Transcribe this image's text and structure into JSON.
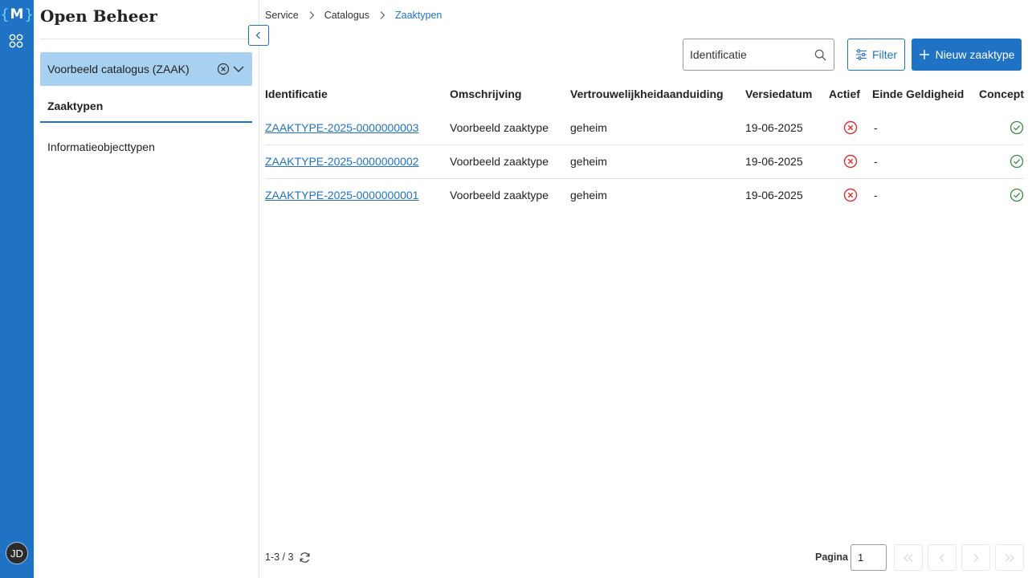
{
  "rail": {
    "logo_letter": "M",
    "user_initials": "JD"
  },
  "sidebar": {
    "brand": "Open Beheer",
    "catalog_select": "Voorbeeld catalogus (ZAAK)",
    "nav": [
      {
        "label": "Zaaktypen",
        "active": true
      },
      {
        "label": "Informatieobjecttypen",
        "active": false
      }
    ]
  },
  "breadcrumb": [
    "Service",
    "Catalogus",
    "Zaaktypen"
  ],
  "toolbar": {
    "search_value": "Identificatie",
    "filter_label": "Filter",
    "new_label": "Nieuw zaaktype"
  },
  "table": {
    "headers": [
      "Identificatie",
      "Omschrijving",
      "Vertrouwelijkheidaanduiding",
      "Versiedatum",
      "Actief",
      "Einde Geldigheid",
      "Concept"
    ],
    "rows": [
      {
        "id": "ZAAKTYPE-2025-0000000003",
        "omschrijving": "Voorbeeld zaaktype",
        "vertrouwelijkheid": "geheim",
        "versiedatum": "19-06-2025",
        "actief": false,
        "einde": "-",
        "concept": true
      },
      {
        "id": "ZAAKTYPE-2025-0000000002",
        "omschrijving": "Voorbeeld zaaktype",
        "vertrouwelijkheid": "geheim",
        "versiedatum": "19-06-2025",
        "actief": false,
        "einde": "-",
        "concept": true
      },
      {
        "id": "ZAAKTYPE-2025-0000000001",
        "omschrijving": "Voorbeeld zaaktype",
        "vertrouwelijkheid": "geheim",
        "versiedatum": "19-06-2025",
        "actief": false,
        "einde": "-",
        "concept": true
      }
    ]
  },
  "footer": {
    "count": "1-3 / 3",
    "pagina_label": "Pagina",
    "page_value": "1"
  },
  "colors": {
    "primary": "#1f72c4",
    "select_bg": "#a8d0f0",
    "status_false": "#d9302c",
    "status_true": "#2e8b3f"
  }
}
